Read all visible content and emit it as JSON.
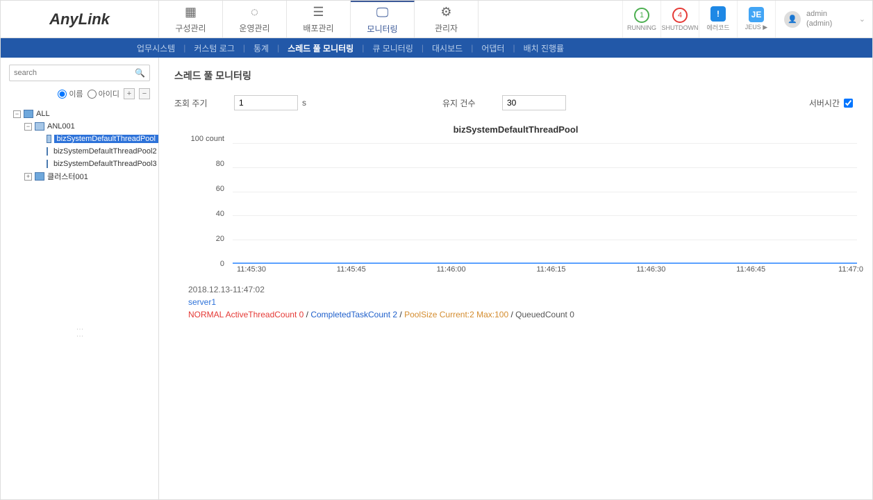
{
  "logo": "AnyLink",
  "top_tabs": [
    {
      "label": "구성관리",
      "icon": "▦"
    },
    {
      "label": "운영관리",
      "icon": "◌"
    },
    {
      "label": "배포관리",
      "icon": "☰"
    },
    {
      "label": "모니터링",
      "icon": "🖵"
    },
    {
      "label": "관리자",
      "icon": "⚙"
    }
  ],
  "status": {
    "running": {
      "count": "1",
      "label": "RUNNING"
    },
    "shutdown": {
      "count": "4",
      "label": "SHUTDOWN"
    },
    "errorcode": {
      "icon": "!",
      "label": "에러코드"
    },
    "jeus": {
      "icon": "JE",
      "label": "JEUS ▶"
    }
  },
  "user": {
    "name": "admin",
    "sub": "(admin)"
  },
  "subnav": [
    "업무시스템",
    "커스텀 로그",
    "통계",
    "스레드 풀 모니터링",
    "큐 모니터링",
    "대시보드",
    "어댑터",
    "배치 진행률"
  ],
  "subnav_active": 3,
  "sidebar": {
    "search_placeholder": "search",
    "radio_name": "이름",
    "radio_id": "아이디",
    "tree": {
      "root": "ALL",
      "anl": "ANL001",
      "pools": [
        "bizSystemDefaultThreadPool",
        "bizSystemDefaultThreadPool2",
        "bizSystemDefaultThreadPool3"
      ],
      "cluster": "클러스터001"
    }
  },
  "page": {
    "title": "스레드 풀 모니터링",
    "cycle_label": "조회 주기",
    "cycle_value": "1",
    "cycle_unit": "s",
    "keep_label": "유지 건수",
    "keep_value": "30",
    "servertime_label": "서버시간"
  },
  "chart_data": {
    "type": "line",
    "title": "bizSystemDefaultThreadPool",
    "ylabel": "count",
    "ylim": [
      0,
      100
    ],
    "y_ticks": [
      0,
      20,
      40,
      60,
      80,
      100
    ],
    "x_ticks": [
      "11:45:30",
      "11:45:45",
      "11:46:00",
      "11:46:15",
      "11:46:30",
      "11:46:45",
      "11:47:0"
    ],
    "series": [
      {
        "name": "ActiveThreadCount",
        "values": [
          0,
          0,
          0,
          0,
          0,
          0,
          0
        ],
        "color": "#e53935"
      },
      {
        "name": "CompletedTaskCount",
        "values": [
          2,
          2,
          2,
          2,
          2,
          2,
          2
        ],
        "color": "#1e5fcb"
      },
      {
        "name": "PoolSize",
        "values": [
          2,
          2,
          2,
          2,
          2,
          2,
          2
        ],
        "color": "#d48c2e"
      },
      {
        "name": "QueuedCount",
        "values": [
          0,
          0,
          0,
          0,
          0,
          0,
          0
        ],
        "color": "#555"
      }
    ],
    "timestamp": "2018.12.13-11:47:02",
    "server": "server1",
    "legend": {
      "normal": "NORMAL ActiveThreadCount 0",
      "completed": "CompletedTaskCount 2",
      "pool": "PoolSize Current:2 Max:100",
      "queued": "QueuedCount 0"
    }
  }
}
